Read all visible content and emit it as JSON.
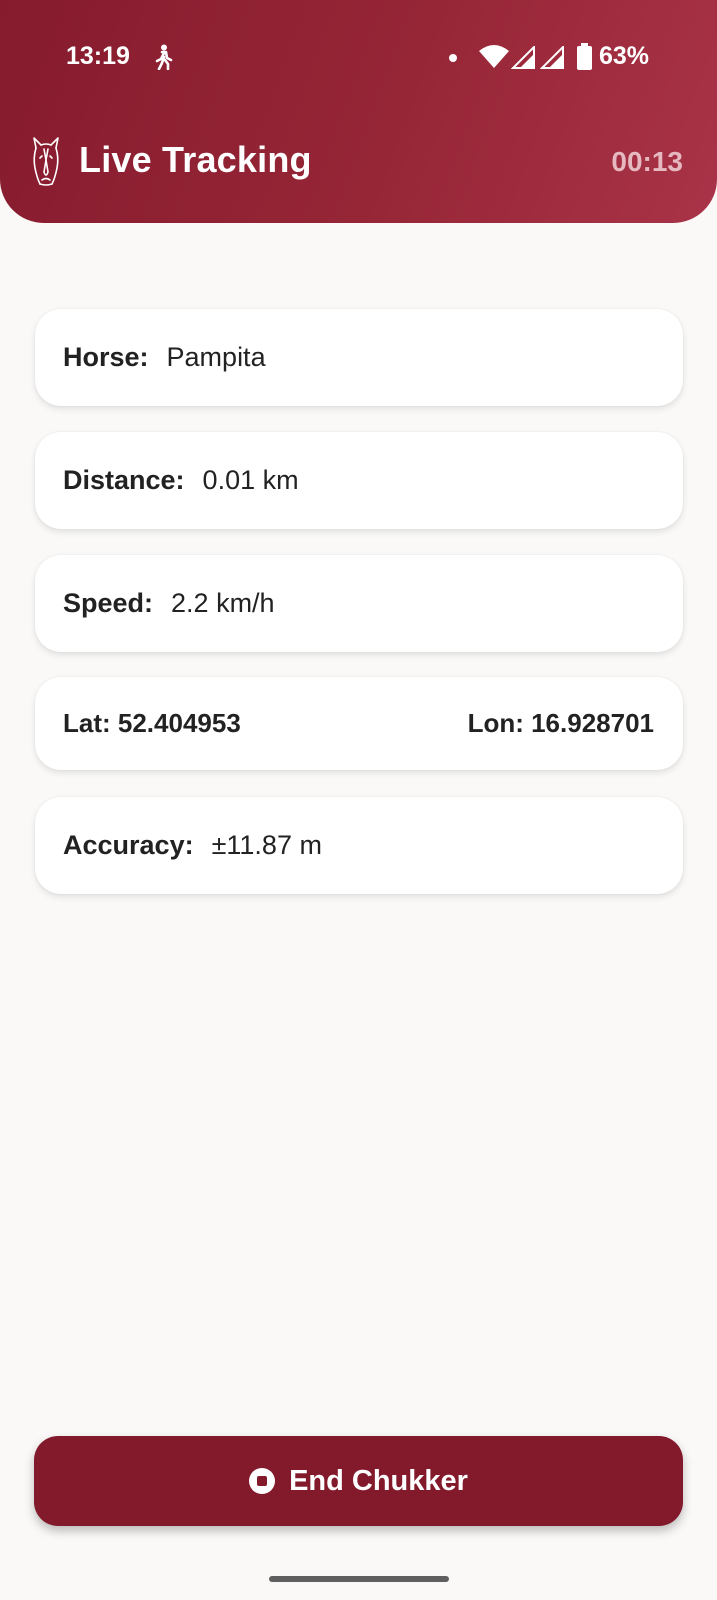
{
  "status_bar": {
    "time": "13:19",
    "battery_percent": "63%",
    "icons": [
      "walk-icon",
      "dot-icon",
      "wifi-icon",
      "signal-icon",
      "signal-icon",
      "battery-icon"
    ]
  },
  "header": {
    "title": "Live Tracking",
    "timer": "00:13",
    "icon": "horse-head-icon"
  },
  "cards": {
    "horse": {
      "label": "Horse:",
      "value": "Pampita"
    },
    "distance": {
      "label": "Distance:",
      "value": "0.01 km"
    },
    "speed": {
      "label": "Speed:",
      "value": "2.2 km/h"
    },
    "coords": {
      "lat": "Lat: 52.404953",
      "lon": "Lon: 16.928701"
    },
    "accuracy": {
      "label": "Accuracy:",
      "value": "±11.87 m"
    }
  },
  "actions": {
    "end_label": "End Chukker",
    "end_icon": "stop-circle-icon"
  },
  "colors": {
    "primary": "#831a2c",
    "header_gradient_start": "#861b2e",
    "header_gradient_end": "#a93348",
    "background": "#faf9f8",
    "timer_text": "#e6b9c0"
  }
}
